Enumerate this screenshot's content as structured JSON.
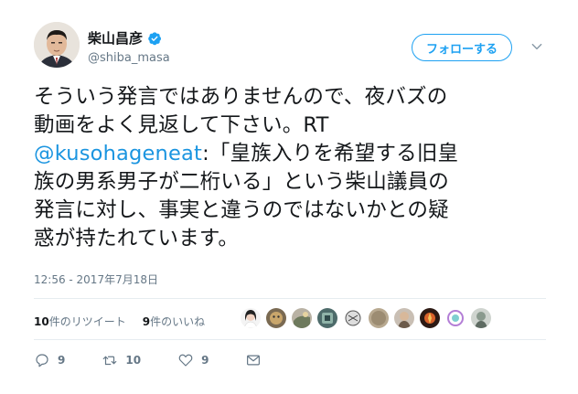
{
  "profile": {
    "name": "柴山昌彦",
    "handle": "@shiba_masa",
    "verified": true
  },
  "follow_button": "フォローする",
  "tweet": {
    "lines": [
      "そういう発言ではありませんので、夜バズの",
      "動画をよく見返して下さい。RT",
      "",
      "族の男系男子が二桁いる」という柴山議員の",
      "発言に対し、事実と違うのではないかとの疑",
      "惑が持たれています。"
    ],
    "mention": "@kusohageneat",
    "line3_rest": ":「皇族入りを希望する旧皇"
  },
  "timestamp": "12:56 - 2017年7月18日",
  "stats": {
    "retweets_count": "10",
    "retweets_label": "件のリツイート",
    "likes_count": "9",
    "likes_label": "件のいいね"
  },
  "actions": {
    "reply_count": "9",
    "retweet_count": "10",
    "like_count": "9"
  },
  "icons": [
    "verified-badge-icon",
    "chevron-down-icon",
    "reply-icon",
    "retweet-icon",
    "heart-icon",
    "mail-icon"
  ],
  "colors": {
    "accent": "#1da1f2",
    "mention": "#1b95e0",
    "muted": "#657786"
  }
}
